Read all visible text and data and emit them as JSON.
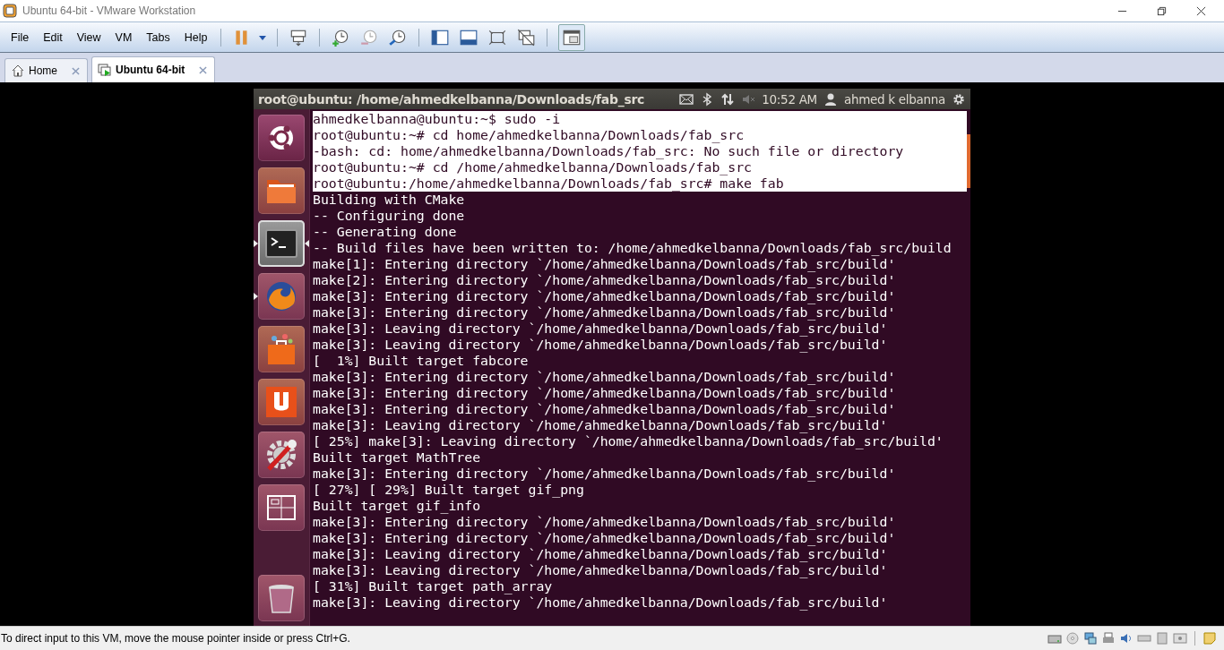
{
  "window": {
    "title": "Ubuntu 64-bit - VMware Workstation"
  },
  "menu": [
    "File",
    "Edit",
    "View",
    "VM",
    "Tabs",
    "Help"
  ],
  "tabs": [
    {
      "label": "Home",
      "selected": false
    },
    {
      "label": "Ubuntu 64-bit",
      "selected": true
    }
  ],
  "panel": {
    "title": "root@ubuntu: /home/ahmedkelbanna/Downloads/fab_src",
    "time": "10:52 AM",
    "user": "ahmed k elbanna"
  },
  "launcher": [
    {
      "kind": "dash",
      "running": false,
      "focused": false
    },
    {
      "kind": "files",
      "running": false,
      "focused": false
    },
    {
      "kind": "terminal",
      "running": true,
      "focused": true
    },
    {
      "kind": "browser",
      "running": true,
      "focused": false
    },
    {
      "kind": "store",
      "running": false,
      "focused": false
    },
    {
      "kind": "cloud",
      "running": false,
      "focused": false
    },
    {
      "kind": "settings",
      "running": false,
      "focused": false
    },
    {
      "kind": "workspaces",
      "running": false,
      "focused": false
    },
    {
      "kind": "trash",
      "running": false,
      "focused": false
    }
  ],
  "terminal": [
    {
      "text": "ahmedkelbanna@ubuntu:~$ sudo -i",
      "selected": true
    },
    {
      "text": "root@ubuntu:~# cd home/ahmedkelbanna/Downloads/fab_src",
      "selected": true
    },
    {
      "text": "-bash: cd: home/ahmedkelbanna/Downloads/fab_src: No such file or directory",
      "selected": true
    },
    {
      "text": "root@ubuntu:~# cd /home/ahmedkelbanna/Downloads/fab_src",
      "selected": true
    },
    {
      "text": "root@ubuntu:/home/ahmedkelbanna/Downloads/fab_src# make fab",
      "selected": true
    },
    {
      "text": "Building with CMake",
      "selected": false
    },
    {
      "text": "-- Configuring done",
      "selected": false
    },
    {
      "text": "-- Generating done",
      "selected": false
    },
    {
      "text": "-- Build files have been written to: /home/ahmedkelbanna/Downloads/fab_src/build",
      "selected": false
    },
    {
      "text": "make[1]: Entering directory `/home/ahmedkelbanna/Downloads/fab_src/build'",
      "selected": false
    },
    {
      "text": "make[2]: Entering directory `/home/ahmedkelbanna/Downloads/fab_src/build'",
      "selected": false
    },
    {
      "text": "make[3]: Entering directory `/home/ahmedkelbanna/Downloads/fab_src/build'",
      "selected": false
    },
    {
      "text": "make[3]: Entering directory `/home/ahmedkelbanna/Downloads/fab_src/build'",
      "selected": false
    },
    {
      "text": "make[3]: Leaving directory `/home/ahmedkelbanna/Downloads/fab_src/build'",
      "selected": false
    },
    {
      "text": "make[3]: Leaving directory `/home/ahmedkelbanna/Downloads/fab_src/build'",
      "selected": false
    },
    {
      "text": "[  1%] Built target fabcore",
      "selected": false
    },
    {
      "text": "make[3]: Entering directory `/home/ahmedkelbanna/Downloads/fab_src/build'",
      "selected": false
    },
    {
      "text": "make[3]: Entering directory `/home/ahmedkelbanna/Downloads/fab_src/build'",
      "selected": false
    },
    {
      "text": "make[3]: Entering directory `/home/ahmedkelbanna/Downloads/fab_src/build'",
      "selected": false
    },
    {
      "text": "make[3]: Leaving directory `/home/ahmedkelbanna/Downloads/fab_src/build'",
      "selected": false
    },
    {
      "text": "[ 25%] make[3]: Leaving directory `/home/ahmedkelbanna/Downloads/fab_src/build'",
      "selected": false
    },
    {
      "text": "Built target MathTree",
      "selected": false
    },
    {
      "text": "make[3]: Entering directory `/home/ahmedkelbanna/Downloads/fab_src/build'",
      "selected": false
    },
    {
      "text": "[ 27%] [ 29%] Built target gif_png",
      "selected": false
    },
    {
      "text": "Built target gif_info",
      "selected": false
    },
    {
      "text": "make[3]: Entering directory `/home/ahmedkelbanna/Downloads/fab_src/build'",
      "selected": false
    },
    {
      "text": "make[3]: Entering directory `/home/ahmedkelbanna/Downloads/fab_src/build'",
      "selected": false
    },
    {
      "text": "make[3]: Leaving directory `/home/ahmedkelbanna/Downloads/fab_src/build'",
      "selected": false
    },
    {
      "text": "make[3]: Leaving directory `/home/ahmedkelbanna/Downloads/fab_src/build'",
      "selected": false
    },
    {
      "text": "[ 31%] Built target path_array",
      "selected": false
    },
    {
      "text": "make[3]: Leaving directory `/home/ahmedkelbanna/Downloads/fab_src/build'",
      "selected": false
    }
  ],
  "status_bar": {
    "text": "To direct input to this VM, move the mouse pointer inside or press Ctrl+G."
  }
}
